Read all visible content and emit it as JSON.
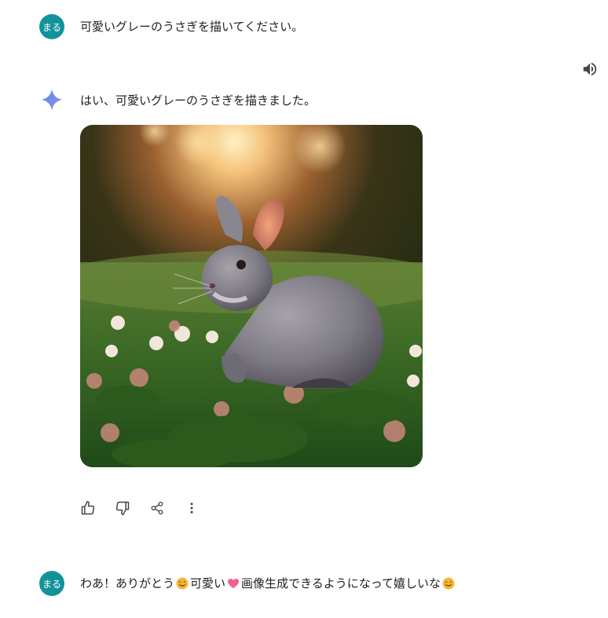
{
  "user": {
    "avatar_text": "まる"
  },
  "messages": {
    "user_prompt": "可愛いグレーのうさぎを描いてください。",
    "assistant_reply": "はい、可愛いグレーのうさぎを描きました。",
    "user_followup": {
      "part1": "わあ！ありがとう",
      "part2": "可愛い",
      "part3": "画像生成できるようになって嬉しいな"
    }
  },
  "icons": {
    "speaker": "speaker-icon",
    "gemini": "gemini-sparkle-icon",
    "thumbs_up": "thumbs-up-icon",
    "thumbs_down": "thumbs-down-icon",
    "share": "share-icon",
    "more": "more-vert-icon",
    "emoji_smile": "smiling-face-emoji",
    "emoji_heart": "pink-heart-emoji"
  },
  "colors": {
    "avatar_bg": "#12939a",
    "gemini_blue": "#4285f4",
    "text": "#1f1f1f",
    "icon": "#444746"
  }
}
